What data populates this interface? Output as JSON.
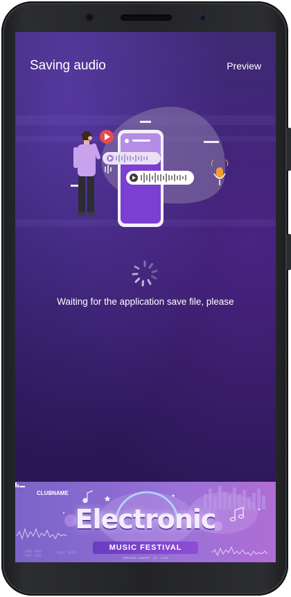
{
  "header": {
    "title": "Saving audio",
    "preview_label": "Preview"
  },
  "status": {
    "message": "Waiting for the application save file, please"
  },
  "ad": {
    "club_name": "CLUBNAME",
    "headline": "Electronic",
    "subheadline": "MUSIC FESTIVAL",
    "fine_print": "SPECIAL LINEUP · DJ · LIVE"
  },
  "colors": {
    "accent_purple": "#7b3fd1",
    "person_shirt": "#c9a2ee",
    "play_red": "#e74c4c",
    "mic_orange": "#f2a02b"
  },
  "icons": [
    "play-icon",
    "microphone-icon",
    "loading-spinner-icon",
    "music-note-icon"
  ]
}
